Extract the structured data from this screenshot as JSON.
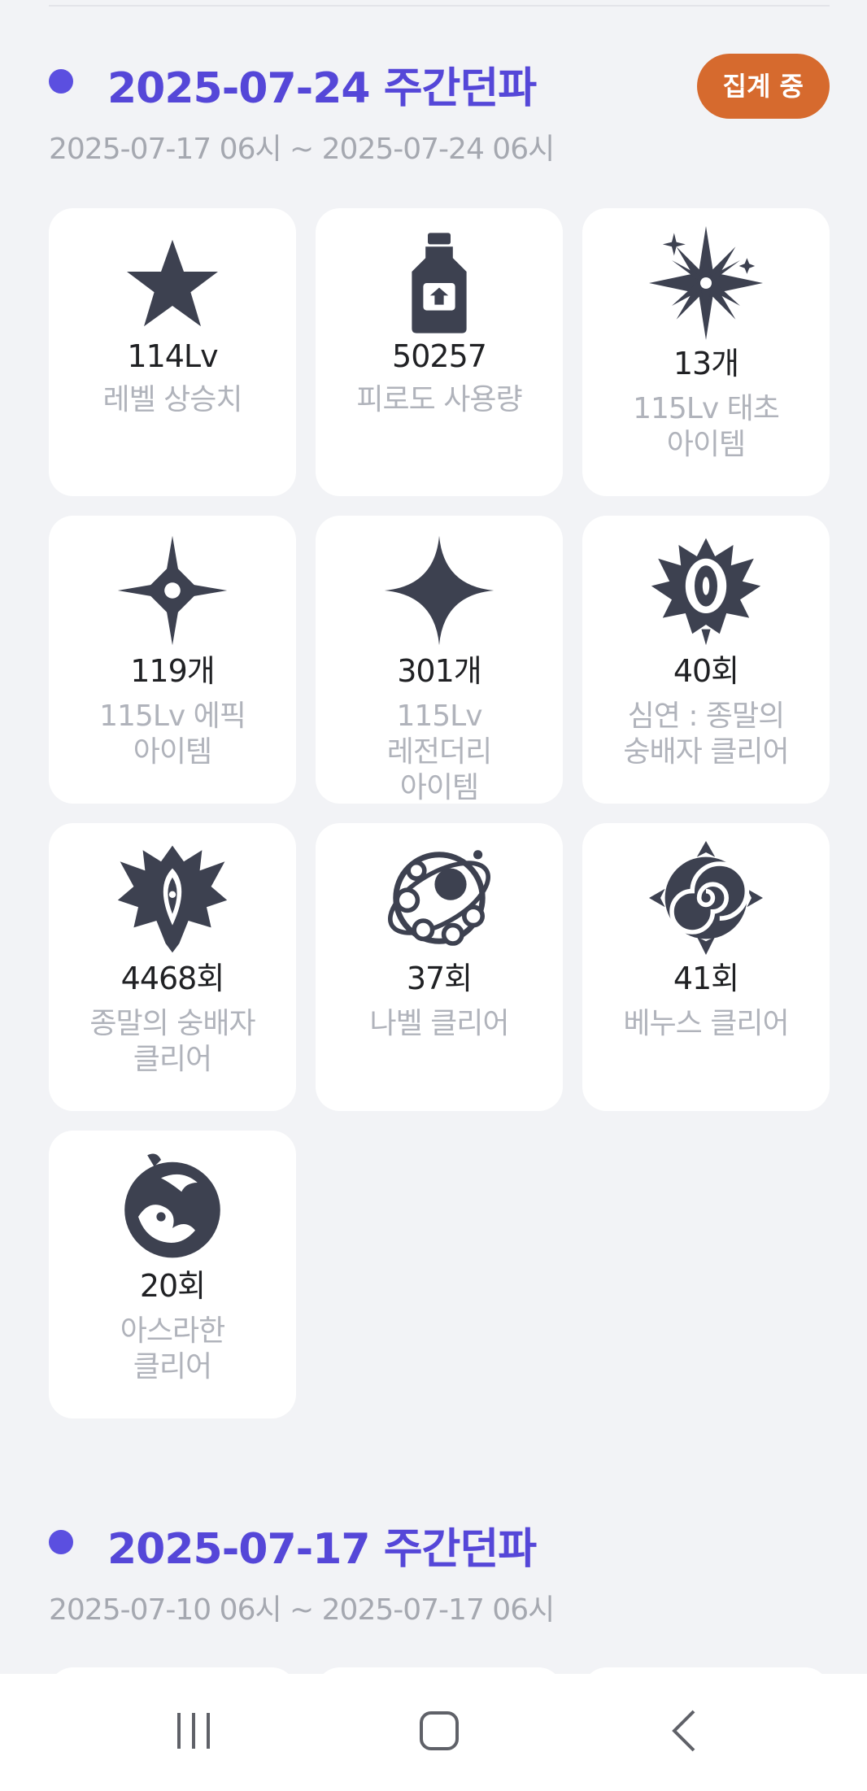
{
  "current": {
    "title": "2025-07-24 주간던파",
    "range": "2025-07-17 06시 ~ 2025-07-24 06시",
    "badge": "집계 중",
    "cards": [
      {
        "icon": "star-icon",
        "value": "114Lv",
        "label": "레벨 상승치"
      },
      {
        "icon": "potion-bottle-icon",
        "value": "50257",
        "label": "피로도 사용량"
      },
      {
        "icon": "burst-star-icon",
        "value": "13개",
        "label": "115Lv 태초\n아이템"
      },
      {
        "icon": "sparkle-icon",
        "value": "119개",
        "label": "115Lv 에픽\n아이템"
      },
      {
        "icon": "four-point-star-icon",
        "value": "301개",
        "label": "115Lv\n레전더리\n아이템"
      },
      {
        "icon": "abyss-crest-icon",
        "value": "40회",
        "label": "심연 : 종말의\n숭배자 클리어"
      },
      {
        "icon": "cult-crest-icon",
        "value": "4468회",
        "label": "종말의 숭배자\n클리어"
      },
      {
        "icon": "nabel-orb-icon",
        "value": "37회",
        "label": "나벨 클리어"
      },
      {
        "icon": "venus-rose-icon",
        "value": "41회",
        "label": "베누스 클리어"
      },
      {
        "icon": "asrahan-wave-icon",
        "value": "20회",
        "label": "아스라한\n클리어"
      }
    ]
  },
  "previous": {
    "title": "2025-07-17 주간던파",
    "range": "2025-07-10 06시 ~ 2025-07-17 06시"
  },
  "navbar": {
    "recents": "recent-apps-icon",
    "home": "home-icon",
    "back": "back-icon"
  },
  "colors": {
    "accent": "#5547d8",
    "badge": "#d66a2e",
    "icon": "#3d4150"
  }
}
